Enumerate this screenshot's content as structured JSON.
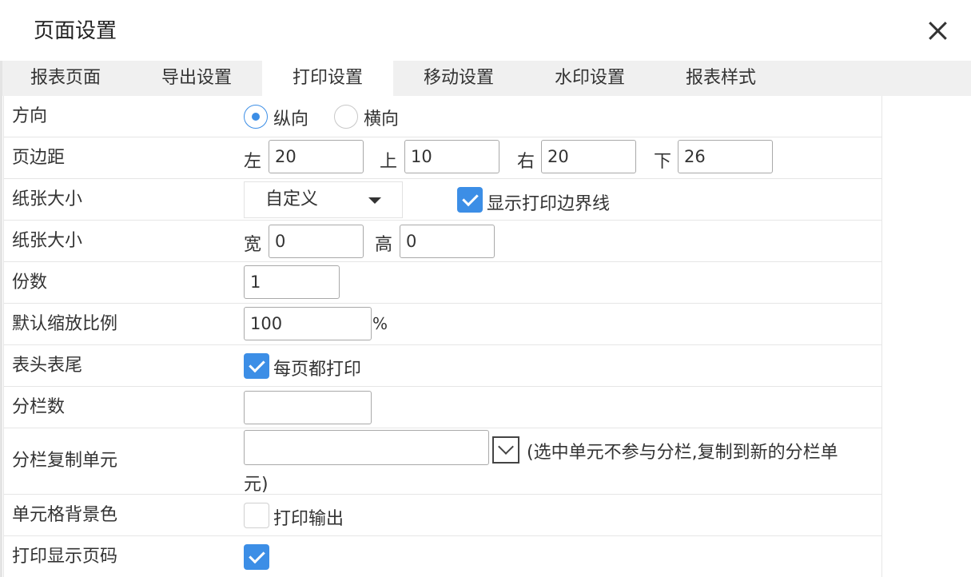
{
  "dialog": {
    "title": "页面设置",
    "close_icon": "close-icon"
  },
  "tabs": [
    {
      "label": "报表页面"
    },
    {
      "label": "导出设置"
    },
    {
      "label": "打印设置",
      "active": true
    },
    {
      "label": "移动设置"
    },
    {
      "label": "水印设置"
    },
    {
      "label": "报表样式"
    }
  ],
  "orientation": {
    "label": "方向",
    "portrait": "纵向",
    "landscape": "横向",
    "selected": "纵向"
  },
  "margins": {
    "label": "页边距",
    "left_label": "左",
    "left": "20",
    "top_label": "上",
    "top": "10",
    "right_label": "右",
    "right": "20",
    "bottom_label": "下",
    "bottom": "26"
  },
  "paper_size": {
    "label": "纸张大小",
    "selected": "自定义",
    "show_border_label": "显示打印边界线",
    "show_border": true
  },
  "paper_dims": {
    "label": "纸张大小",
    "width_label": "宽",
    "width": "0",
    "height_label": "高",
    "height": "0"
  },
  "copies": {
    "label": "份数",
    "value": "1"
  },
  "zoom": {
    "label": "默认缩放比例",
    "value": "100",
    "unit": "%"
  },
  "header_footer": {
    "label": "表头表尾",
    "checkbox_label": "每页都打印",
    "checked": true
  },
  "columns": {
    "label": "分栏数",
    "value": ""
  },
  "column_copy": {
    "label": "分栏复制单元",
    "value": "",
    "hint_line1": "(选中单元不参与分栏,复制到新的分栏单",
    "hint_line2": "元)"
  },
  "cell_bg": {
    "label": "单元格背景色",
    "checkbox_label": "打印输出",
    "checked": false
  },
  "page_number": {
    "label": "打印显示页码",
    "checked": true
  },
  "colors": {
    "accent": "#3c8ee6",
    "tabbar": "#f0f0f0",
    "border": "#e6e6e6"
  }
}
